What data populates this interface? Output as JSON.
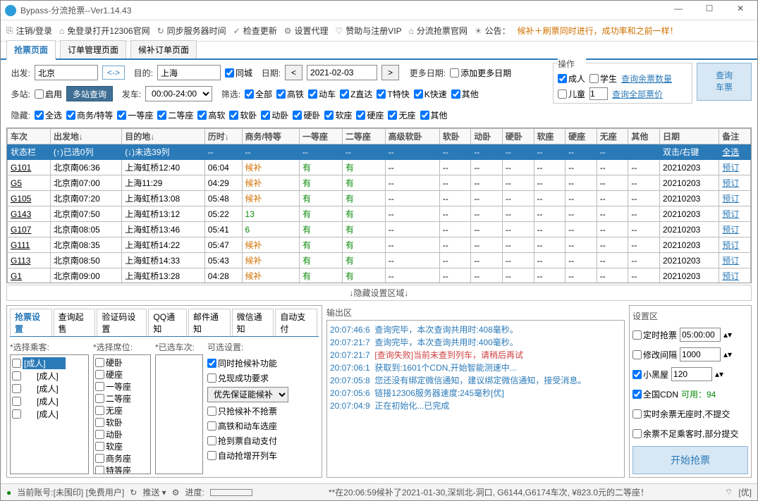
{
  "window": {
    "title": "Bypass-分流抢票--Ver1.14.43"
  },
  "toolbar": {
    "logout": "注销/登录",
    "openSite": "免登录打开12306官网",
    "sync": "同步服务器时间",
    "check": "检查更新",
    "proxy": "设置代理",
    "vip": "赞助与注册VIP",
    "official": "分流抢票官网",
    "announceLabel": "公告：",
    "announce": "候补＋刷票同时进行，成功率和之前一样！"
  },
  "tabs": {
    "t1": "抢票页面",
    "t2": "订单管理页面",
    "t3": "候补订单页面"
  },
  "search": {
    "from_l": "出发:",
    "from": "北京",
    "to_l": "目的:",
    "to": "上海",
    "samecity": "同城",
    "date_l": "日期:",
    "date": "2021-02-03",
    "more_l": "更多日期:",
    "adddates": "添加更多日期",
    "multi_l": "多站:",
    "enable": "启用",
    "multi_btn": "多站查询",
    "depart_l": "发车:",
    "depart": "00:00-24:00",
    "filter_l": "筛选:",
    "f_all": "全部",
    "f_g": "高铁",
    "f_d": "动车",
    "f_z": "Z直达",
    "f_t": "T特快",
    "f_k": "K快速",
    "f_o": "其他",
    "hide_l": "隐藏:",
    "h_all": "全选",
    "h_sw": "商务/特等",
    "h_1": "一等座",
    "h_2": "二等座",
    "h_gr": "高软",
    "h_rw": "软卧",
    "h_dw": "动卧",
    "h_yw": "硬卧",
    "h_rz": "软座",
    "h_yz": "硬座",
    "h_wz": "无座",
    "h_ot": "其他"
  },
  "op": {
    "hdr": "操作",
    "adult": "成人",
    "student": "学生",
    "child": "儿童",
    "childn": "1",
    "link1": "查询余票数量",
    "link2": "查询全部票价",
    "btn": "查询\n车票"
  },
  "cols": [
    "车次",
    "出发地↓",
    "目的地↓",
    "历时↓",
    "商务/特等",
    "一等座",
    "二等座",
    "高级软卧",
    "软卧",
    "动卧",
    "硬卧",
    "软座",
    "硬座",
    "无座",
    "其他",
    "日期",
    "备注"
  ],
  "statusrow": {
    "a": "状态栏",
    "b": "(↑)已选0列",
    "c": "(↓)未选39列",
    "tip": "双击/右键",
    "last": "全选"
  },
  "rows": [
    {
      "no": "G101",
      "dep": "北京南06:36",
      "arr": "上海虹桥12:40",
      "dur": "06:04",
      "sw": "候补",
      "y1": "有",
      "y2": "有",
      "date": "20210203",
      "book": "预订"
    },
    {
      "no": "G5",
      "dep": "北京南07:00",
      "arr": "上海11:29",
      "dur": "04:29",
      "sw": "候补",
      "y1": "有",
      "y2": "有",
      "date": "20210203",
      "book": "预订"
    },
    {
      "no": "G105",
      "dep": "北京南07:20",
      "arr": "上海虹桥13:08",
      "dur": "05:48",
      "sw": "候补",
      "y1": "有",
      "y2": "有",
      "date": "20210203",
      "book": "预订"
    },
    {
      "no": "G143",
      "dep": "北京南07:50",
      "arr": "上海虹桥13:12",
      "dur": "05:22",
      "sw": "13",
      "y1": "有",
      "y2": "有",
      "date": "20210203",
      "book": "预订"
    },
    {
      "no": "G107",
      "dep": "北京南08:05",
      "arr": "上海虹桥13:46",
      "dur": "05:41",
      "sw": "6",
      "y1": "有",
      "y2": "有",
      "date": "20210203",
      "book": "预订"
    },
    {
      "no": "G111",
      "dep": "北京南08:35",
      "arr": "上海虹桥14:22",
      "dur": "05:47",
      "sw": "候补",
      "y1": "有",
      "y2": "有",
      "date": "20210203",
      "book": "预订"
    },
    {
      "no": "G113",
      "dep": "北京南08:50",
      "arr": "上海虹桥14:33",
      "dur": "05:43",
      "sw": "候补",
      "y1": "有",
      "y2": "有",
      "date": "20210203",
      "book": "预订"
    },
    {
      "no": "G1",
      "dep": "北京南09:00",
      "arr": "上海虹桥13:28",
      "dur": "04:28",
      "sw": "候补",
      "y1": "有",
      "y2": "有",
      "date": "20210203",
      "book": "预订"
    }
  ],
  "hidezone": "↓隐藏设置区域↓",
  "stabs": [
    "抢票设置",
    "查询起售",
    "验证码设置",
    "QQ通知",
    "邮件通知",
    "微信通知",
    "自动支付"
  ],
  "passhdr": "*选择乘客:",
  "seathdr": "*选择席位:",
  "carhdr": "*已选车次:",
  "opthdr": "可选设置:",
  "passengers": [
    "[成人]",
    "[成人]",
    "[成人]",
    "[成人]",
    "[成人]"
  ],
  "seats": [
    "硬卧",
    "硬座",
    "一等座",
    "二等座",
    "无座",
    "软卧",
    "动卧",
    "软座",
    "商务座",
    "特等座"
  ],
  "opts": {
    "o1": "同时抢候补功能",
    "o2": "兑现成功要求",
    "sel": "优先保证能候补",
    "o3": "只抢候补不抢票",
    "o4": "高铁和动车选座",
    "o5": "抢到票自动支付",
    "o6": "自动抢增开列车"
  },
  "loghdr": "输出区",
  "log": [
    {
      "t": "20:07:46:6",
      "m": "查询完毕，本次查询共用时:408毫秒。"
    },
    {
      "t": "20:07:21:7",
      "m": "查询完毕，本次查询共用时:400毫秒。"
    },
    {
      "t": "20:07:21:7",
      "m": "[查询失败]当前未查到列车，请稍后再试",
      "fail": true
    },
    {
      "t": "20:07:06:1",
      "m": "获取到:1601个CDN,开始智能测速中..."
    },
    {
      "t": "20:07:05:8",
      "m": "您还没有绑定微信通知，建议绑定微信通知，接受消息。"
    },
    {
      "t": "20:07:05:6",
      "m": "链接12306服务器速度:245毫秒[优]"
    },
    {
      "t": "20:07:04:9",
      "m": "正在初始化...已完成"
    }
  ],
  "cfghdr": "设置区",
  "cfg": {
    "c1": "定时抢票",
    "v1": "05:00:00",
    "c2": "修改间隔",
    "v2": "1000",
    "c3": "小黑屋",
    "v3": "120",
    "c4": "全国CDN",
    "cdn": "可用：94",
    "c5": "实时余票无座时,不提交",
    "c6": "余票不足乘客时,部分提交",
    "start": "开始抢票"
  },
  "status": {
    "acct": "当前账号:[未围印] [免费用户]",
    "push": "推送 ▾",
    "prog": "进度:",
    "msg": "**在20:06:59候补了2021-01-30,深圳北-洞口, G6144,G6174车次, ¥823.0元的二等座！",
    "wifi": "[优]"
  }
}
